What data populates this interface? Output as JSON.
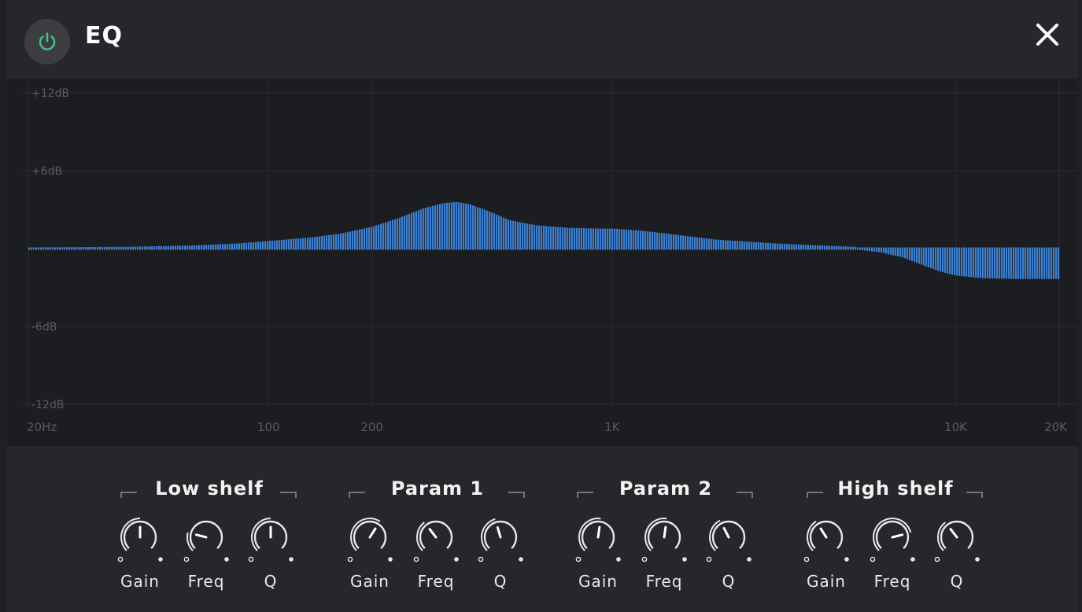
{
  "header": {
    "title": "EQ",
    "power_icon": "power-icon",
    "close_icon": "close-icon",
    "power_color": "#3ec08a"
  },
  "graph": {
    "db_labels": [
      "+12dB",
      "+6dB",
      "-6dB",
      "-12dB"
    ],
    "db_values": [
      12,
      6,
      -6,
      -12
    ],
    "freq_labels": [
      "20Hz",
      "100",
      "200",
      "1K",
      "10K",
      "20K"
    ],
    "freq_values": [
      20,
      100,
      200,
      1000,
      10000,
      20000
    ],
    "curve_color": "#3a7fd1",
    "response": [
      [
        20,
        0
      ],
      [
        40,
        0.05
      ],
      [
        60,
        0.15
      ],
      [
        80,
        0.3
      ],
      [
        100,
        0.5
      ],
      [
        130,
        0.75
      ],
      [
        160,
        1.05
      ],
      [
        200,
        1.6
      ],
      [
        240,
        2.3
      ],
      [
        280,
        3.0
      ],
      [
        320,
        3.4
      ],
      [
        350,
        3.5
      ],
      [
        380,
        3.35
      ],
      [
        430,
        2.85
      ],
      [
        500,
        2.1
      ],
      [
        600,
        1.7
      ],
      [
        750,
        1.5
      ],
      [
        900,
        1.45
      ],
      [
        1000,
        1.45
      ],
      [
        1200,
        1.3
      ],
      [
        1500,
        1.0
      ],
      [
        2000,
        0.6
      ],
      [
        3000,
        0.3
      ],
      [
        4000,
        0.15
      ],
      [
        5000,
        0.05
      ],
      [
        6000,
        -0.2
      ],
      [
        7000,
        -0.6
      ],
      [
        8000,
        -1.2
      ],
      [
        9000,
        -1.7
      ],
      [
        10000,
        -2.0
      ],
      [
        12000,
        -2.2
      ],
      [
        15000,
        -2.25
      ],
      [
        20000,
        -2.25
      ]
    ]
  },
  "bands": [
    {
      "name": "Low shelf",
      "knobs": [
        {
          "label": "Gain",
          "value": 0.5
        },
        {
          "label": "Freq",
          "value": 0.22
        },
        {
          "label": "Q",
          "value": 0.5
        }
      ]
    },
    {
      "name": "Param 1",
      "knobs": [
        {
          "label": "Gain",
          "value": 0.62
        },
        {
          "label": "Freq",
          "value": 0.36
        },
        {
          "label": "Q",
          "value": 0.44
        }
      ]
    },
    {
      "name": "Param 2",
      "knobs": [
        {
          "label": "Gain",
          "value": 0.53
        },
        {
          "label": "Freq",
          "value": 0.53
        },
        {
          "label": "Q",
          "value": 0.4
        }
      ]
    },
    {
      "name": "High shelf",
      "knobs": [
        {
          "label": "Gain",
          "value": 0.38
        },
        {
          "label": "Freq",
          "value": 0.78
        },
        {
          "label": "Q",
          "value": 0.36
        }
      ]
    }
  ]
}
